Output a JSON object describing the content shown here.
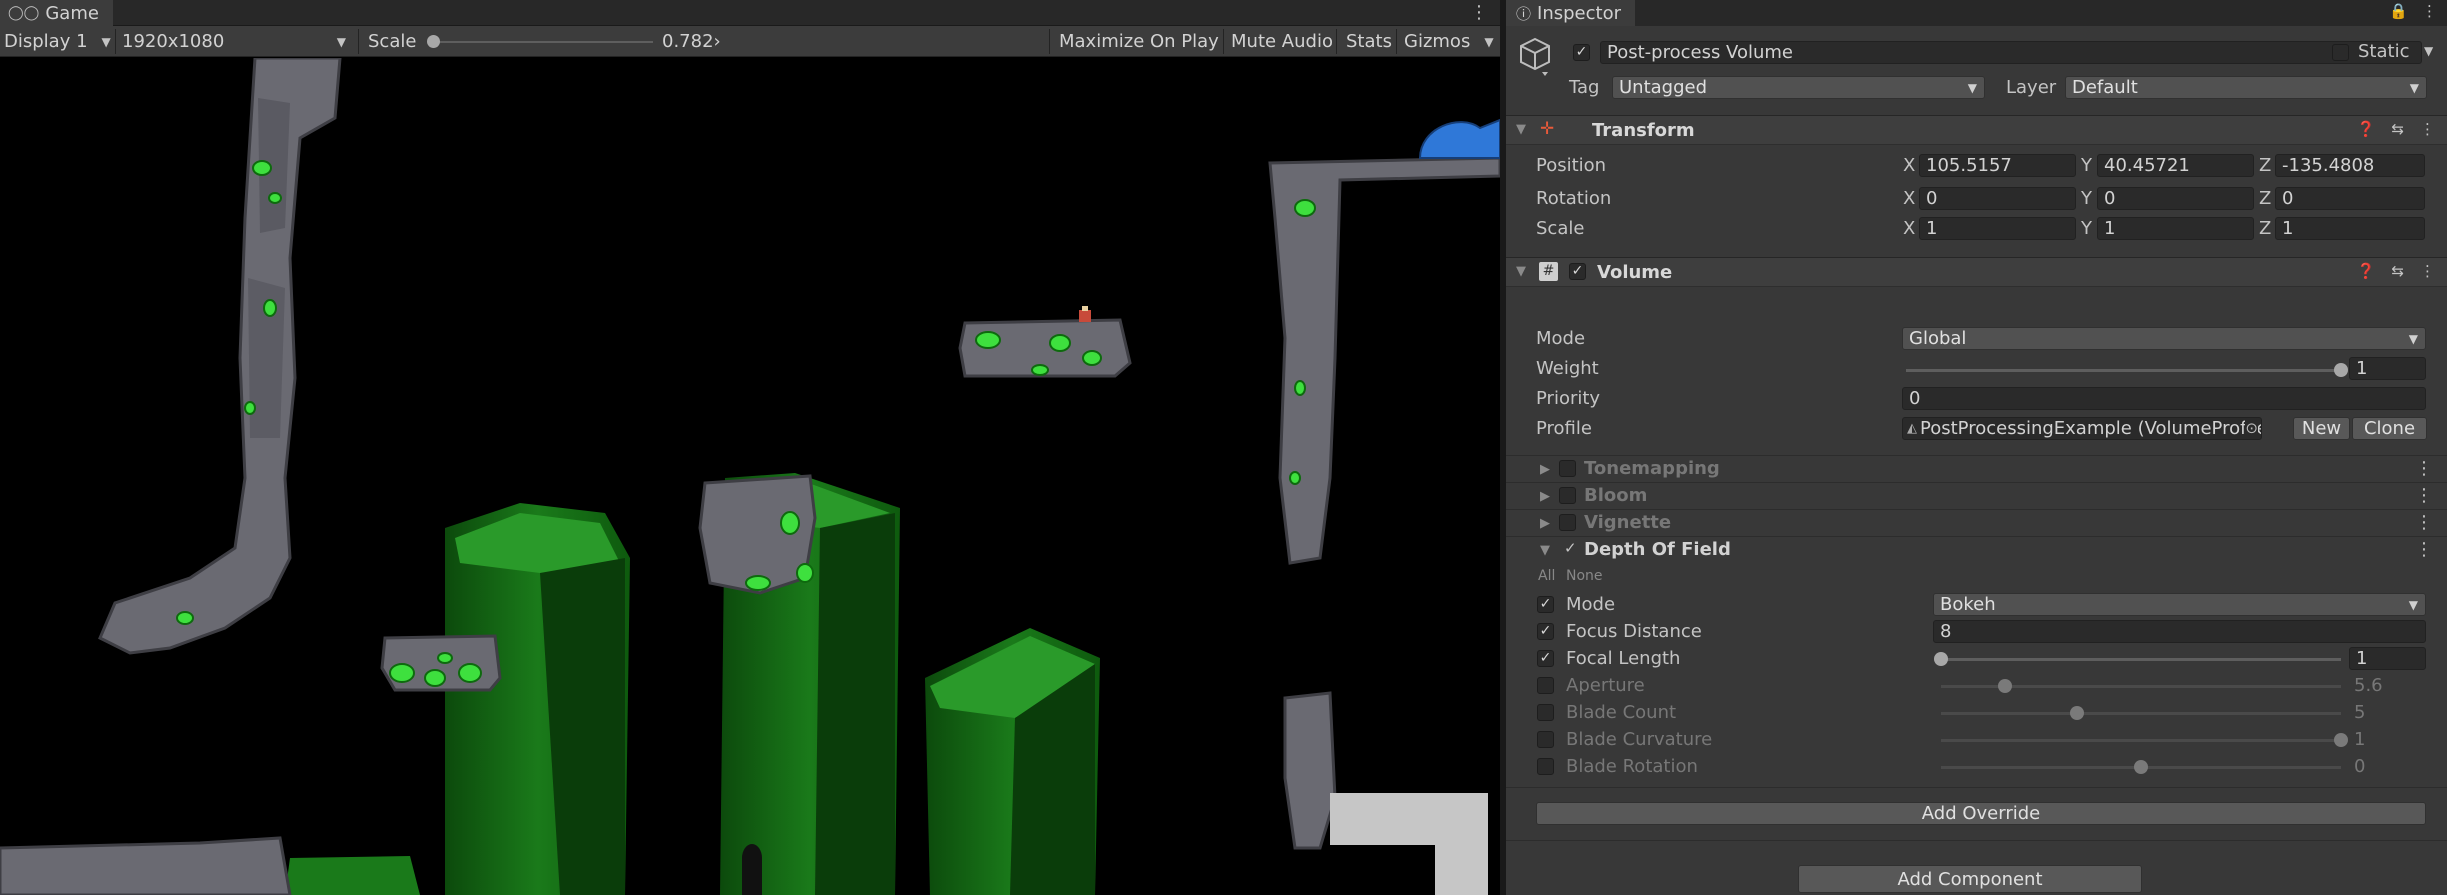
{
  "game": {
    "tab_label": "Game",
    "display": "Display 1",
    "resolution": "1920x1080",
    "scale_label": "Scale",
    "scale_value": "0.782›",
    "scale_fraction": 0.0,
    "maximize_on_play": "Maximize On Play",
    "mute_audio": "Mute Audio",
    "stats": "Stats",
    "gizmos": "Gizmos"
  },
  "inspector": {
    "tab_label": "Inspector",
    "object_name": "Post-process Volume",
    "static_label": "Static",
    "tag_label": "Tag",
    "tag_value": "Untagged",
    "layer_label": "Layer",
    "layer_value": "Default",
    "transform": {
      "title": "Transform",
      "position_label": "Position",
      "rotation_label": "Rotation",
      "scale_label": "Scale",
      "position": {
        "x": "105.5157",
        "y": "40.45721",
        "z": "-135.4808"
      },
      "rotation": {
        "x": "0",
        "y": "0",
        "z": "0"
      },
      "scale": {
        "x": "1",
        "y": "1",
        "z": "1"
      }
    },
    "volume": {
      "title": "Volume",
      "mode_label": "Mode",
      "mode_value": "Global",
      "weight_label": "Weight",
      "weight_value": "1",
      "weight_fraction": 1.0,
      "priority_label": "Priority",
      "priority_value": "0",
      "profile_label": "Profile",
      "profile_value": "PostProcessingExample (VolumeProfile",
      "new_button": "New",
      "clone_button": "Clone"
    },
    "overrides": [
      {
        "name": "Tonemapping",
        "enabled": false
      },
      {
        "name": "Bloom",
        "enabled": false
      },
      {
        "name": "Vignette",
        "enabled": false
      },
      {
        "name": "Depth Of Field",
        "enabled": true
      }
    ],
    "all_label": "All",
    "none_label": "None",
    "dof": {
      "mode_label": "Mode",
      "mode_value": "Bokeh",
      "focus_distance_label": "Focus Distance",
      "focus_distance_value": "8",
      "focal_length_label": "Focal Length",
      "focal_length_value": "1",
      "focal_length_fraction": 0.0,
      "aperture_label": "Aperture",
      "aperture_value": "5.6",
      "aperture_fraction": 0.16,
      "blade_count_label": "Blade Count",
      "blade_count_value": "5",
      "blade_count_fraction": 0.34,
      "blade_curvature_label": "Blade Curvature",
      "blade_curvature_value": "1",
      "blade_curvature_fraction": 1.0,
      "blade_rotation_label": "Blade Rotation",
      "blade_rotation_value": "0",
      "blade_rotation_fraction": 0.5
    },
    "add_override": "Add Override",
    "add_component": "Add Component"
  },
  "colors": {
    "stone": "#6a6a72",
    "crystal": "#1e7a1e",
    "gem": "#3ee03e"
  }
}
